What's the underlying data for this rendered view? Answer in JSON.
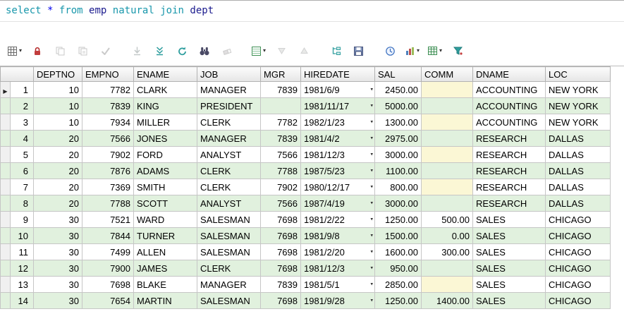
{
  "sql": {
    "tokens": [
      {
        "text": "select",
        "type": "keyword"
      },
      {
        "text": " ",
        "type": "plain"
      },
      {
        "text": "*",
        "type": "operator"
      },
      {
        "text": " ",
        "type": "plain"
      },
      {
        "text": "from",
        "type": "keyword"
      },
      {
        "text": " ",
        "type": "plain"
      },
      {
        "text": "emp",
        "type": "identifier"
      },
      {
        "text": " ",
        "type": "plain"
      },
      {
        "text": "natural",
        "type": "keyword"
      },
      {
        "text": " ",
        "type": "plain"
      },
      {
        "text": "join",
        "type": "keyword"
      },
      {
        "text": " ",
        "type": "plain"
      },
      {
        "text": "dept",
        "type": "identifier"
      }
    ]
  },
  "toolbar": {
    "buttons": [
      {
        "name": "query-data",
        "icon": "grid",
        "dropdown": true
      },
      {
        "name": "lock",
        "icon": "lock"
      },
      {
        "name": "copy",
        "icon": "copy",
        "disabled": true
      },
      {
        "name": "copy-append",
        "icon": "copy2",
        "disabled": true
      },
      {
        "name": "post-changes",
        "icon": "check",
        "disabled": true
      },
      {
        "separator": true
      },
      {
        "name": "fetch-next",
        "icon": "arrow-down",
        "disabled": true
      },
      {
        "name": "fetch-all",
        "icon": "double-arrow-down"
      },
      {
        "name": "refresh",
        "icon": "refresh"
      },
      {
        "name": "find",
        "icon": "binoculars"
      },
      {
        "name": "clear",
        "icon": "eraser",
        "disabled": true
      },
      {
        "separator": true
      },
      {
        "name": "report",
        "icon": "report",
        "dropdown": true
      },
      {
        "name": "sort-descending",
        "icon": "triangle-down",
        "disabled": true
      },
      {
        "name": "sort-ascending",
        "icon": "triangle-up",
        "disabled": true
      },
      {
        "separator": true
      },
      {
        "name": "master-detail",
        "icon": "branch"
      },
      {
        "name": "save",
        "icon": "floppy"
      },
      {
        "separator": true
      },
      {
        "name": "history",
        "icon": "clock"
      },
      {
        "name": "chart",
        "icon": "barchart",
        "dropdown": true
      },
      {
        "name": "pivot-table",
        "icon": "table",
        "dropdown": true
      },
      {
        "name": "filter",
        "icon": "funnel"
      }
    ]
  },
  "grid": {
    "columns": [
      {
        "key": "deptno",
        "label": "DEPTNO",
        "align": "right"
      },
      {
        "key": "empno",
        "label": "EMPNO",
        "align": "right"
      },
      {
        "key": "ename",
        "label": "ENAME",
        "align": "left"
      },
      {
        "key": "job",
        "label": "JOB",
        "align": "left"
      },
      {
        "key": "mgr",
        "label": "MGR",
        "align": "right"
      },
      {
        "key": "hiredate",
        "label": "HIREDATE",
        "align": "left"
      },
      {
        "key": "sal",
        "label": "SAL",
        "align": "right"
      },
      {
        "key": "comm",
        "label": "COMM",
        "align": "right"
      },
      {
        "key": "dname",
        "label": "DNAME",
        "align": "left"
      },
      {
        "key": "loc",
        "label": "LOC",
        "align": "left"
      }
    ],
    "rows": [
      {
        "num": 1,
        "current": true,
        "cells": {
          "deptno": "10",
          "empno": "7782",
          "ename": "CLARK",
          "job": "MANAGER",
          "mgr": "7839",
          "hiredate": "1981/6/9",
          "sal": "2450.00",
          "comm": "",
          "dname": "ACCOUNTING",
          "loc": "NEW YORK"
        }
      },
      {
        "num": 2,
        "current": false,
        "cells": {
          "deptno": "10",
          "empno": "7839",
          "ename": "KING",
          "job": "PRESIDENT",
          "mgr": "",
          "hiredate": "1981/11/17",
          "sal": "5000.00",
          "comm": "",
          "dname": "ACCOUNTING",
          "loc": "NEW YORK"
        }
      },
      {
        "num": 3,
        "current": false,
        "cells": {
          "deptno": "10",
          "empno": "7934",
          "ename": "MILLER",
          "job": "CLERK",
          "mgr": "7782",
          "hiredate": "1982/1/23",
          "sal": "1300.00",
          "comm": "",
          "dname": "ACCOUNTING",
          "loc": "NEW YORK"
        }
      },
      {
        "num": 4,
        "current": false,
        "cells": {
          "deptno": "20",
          "empno": "7566",
          "ename": "JONES",
          "job": "MANAGER",
          "mgr": "7839",
          "hiredate": "1981/4/2",
          "sal": "2975.00",
          "comm": "",
          "dname": "RESEARCH",
          "loc": "DALLAS"
        }
      },
      {
        "num": 5,
        "current": false,
        "cells": {
          "deptno": "20",
          "empno": "7902",
          "ename": "FORD",
          "job": "ANALYST",
          "mgr": "7566",
          "hiredate": "1981/12/3",
          "sal": "3000.00",
          "comm": "",
          "dname": "RESEARCH",
          "loc": "DALLAS"
        }
      },
      {
        "num": 6,
        "current": false,
        "cells": {
          "deptno": "20",
          "empno": "7876",
          "ename": "ADAMS",
          "job": "CLERK",
          "mgr": "7788",
          "hiredate": "1987/5/23",
          "sal": "1100.00",
          "comm": "",
          "dname": "RESEARCH",
          "loc": "DALLAS"
        }
      },
      {
        "num": 7,
        "current": false,
        "cells": {
          "deptno": "20",
          "empno": "7369",
          "ename": "SMITH",
          "job": "CLERK",
          "mgr": "7902",
          "hiredate": "1980/12/17",
          "sal": "800.00",
          "comm": "",
          "dname": "RESEARCH",
          "loc": "DALLAS"
        }
      },
      {
        "num": 8,
        "current": false,
        "cells": {
          "deptno": "20",
          "empno": "7788",
          "ename": "SCOTT",
          "job": "ANALYST",
          "mgr": "7566",
          "hiredate": "1987/4/19",
          "sal": "3000.00",
          "comm": "",
          "dname": "RESEARCH",
          "loc": "DALLAS"
        }
      },
      {
        "num": 9,
        "current": false,
        "cells": {
          "deptno": "30",
          "empno": "7521",
          "ename": "WARD",
          "job": "SALESMAN",
          "mgr": "7698",
          "hiredate": "1981/2/22",
          "sal": "1250.00",
          "comm": "500.00",
          "dname": "SALES",
          "loc": "CHICAGO"
        }
      },
      {
        "num": 10,
        "current": false,
        "cells": {
          "deptno": "30",
          "empno": "7844",
          "ename": "TURNER",
          "job": "SALESMAN",
          "mgr": "7698",
          "hiredate": "1981/9/8",
          "sal": "1500.00",
          "comm": "0.00",
          "dname": "SALES",
          "loc": "CHICAGO"
        }
      },
      {
        "num": 11,
        "current": false,
        "cells": {
          "deptno": "30",
          "empno": "7499",
          "ename": "ALLEN",
          "job": "SALESMAN",
          "mgr": "7698",
          "hiredate": "1981/2/20",
          "sal": "1600.00",
          "comm": "300.00",
          "dname": "SALES",
          "loc": "CHICAGO"
        }
      },
      {
        "num": 12,
        "current": false,
        "cells": {
          "deptno": "30",
          "empno": "7900",
          "ename": "JAMES",
          "job": "CLERK",
          "mgr": "7698",
          "hiredate": "1981/12/3",
          "sal": "950.00",
          "comm": "",
          "dname": "SALES",
          "loc": "CHICAGO"
        }
      },
      {
        "num": 13,
        "current": false,
        "cells": {
          "deptno": "30",
          "empno": "7698",
          "ename": "BLAKE",
          "job": "MANAGER",
          "mgr": "7839",
          "hiredate": "1981/5/1",
          "sal": "2850.00",
          "comm": "",
          "dname": "SALES",
          "loc": "CHICAGO"
        }
      },
      {
        "num": 14,
        "current": false,
        "cells": {
          "deptno": "30",
          "empno": "7654",
          "ename": "MARTIN",
          "job": "SALESMAN",
          "mgr": "7698",
          "hiredate": "1981/9/28",
          "sal": "1250.00",
          "comm": "1400.00",
          "dname": "SALES",
          "loc": "CHICAGO"
        }
      }
    ]
  }
}
